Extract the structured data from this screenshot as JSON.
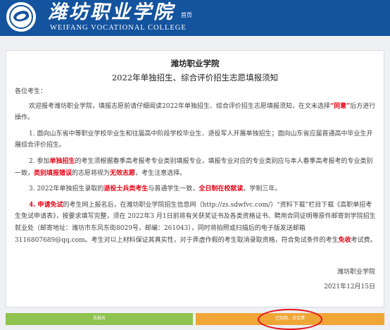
{
  "header": {
    "brand_cn": "潍坊职业学院",
    "brand_en": "WEIFANG VOCATIONAL COLLEGE",
    "home_link": "首页"
  },
  "notice": {
    "school": "潍坊职业学院",
    "title": "2022年单独招生、综合评价招生志愿填报须知",
    "salutation": "各位考生：",
    "intro": [
      "欢迎报考潍坊职业学院，填报志愿前请仔细阅读2022年单独招生、综合评价招生志愿填报须知，在文末选择",
      "“同意”",
      "后方进行操作。"
    ],
    "item1": "1. 面向山东省中等职业学校毕业生和往届高中阶段学校毕业生、退役军人开展单独招生；面向山东省应届普通高中毕业生开展综合评价招生。",
    "item2": [
      "2. 参加",
      "单独招生",
      "的考生须根据春季高考报考专业类别填报专业，填报专业对应的专业类别应与本人春季高考报考的专业类别一致，",
      "类别填报错误",
      "的志愿将视为",
      "无效志愿",
      "，考生注意选择。"
    ],
    "item3": [
      "3. 2022年单独招生录取的",
      "退役士兵类考生",
      "与普通学生一致，",
      "全日制在校就读",
      "，学制三年。"
    ],
    "item4": [
      "4. ",
      "申请免试",
      "的考生网上报名后，在潍坊职业学院招生信息网（http://zs.sdwfvc.com/）“资料下载”栏目下载《高职单招考生免试申请表》，按要求填写完整，须在 2022年3 月1日前将有关获奖证书及各类资格证书、聘用合同证明等原件邮寄到学院招生就业处（邮寄地址：潍坊市东风东街8029号，邮编：261043），同时将拍照或扫描后的电子版发送邮箱 3116807689@qq.com。考生对以上材料保证其真实性，对于弄虚作假的考生取消录取资格，符合免试条件的考生",
      "免收",
      "考试费。"
    ],
    "signature": "潍坊职业学院",
    "date": "2021年12月15日"
  },
  "buttons": {
    "back": "去报名",
    "confirm": "已知晓，去交费"
  },
  "colors": {
    "header_bg": "#14539e",
    "emphasis_red": "#e60012",
    "back_button": "#8fc34f",
    "confirm_button": "#f0a637",
    "annotation_circle": "#e4101b"
  }
}
